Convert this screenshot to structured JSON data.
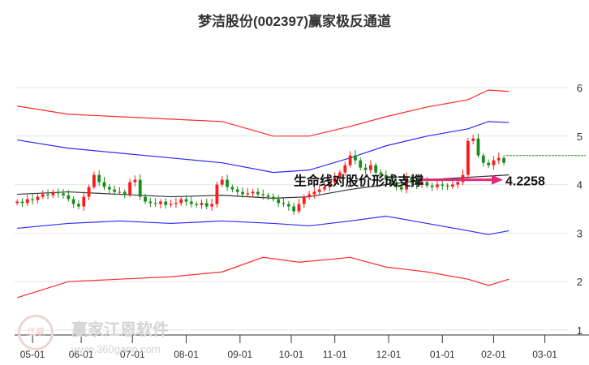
{
  "chart_data": {
    "type": "candlestick",
    "title": "梦洁股份(002397)赢家极反通道",
    "ylim": [
      1,
      6.5
    ],
    "yticks": [
      1,
      2,
      3,
      4,
      5,
      6
    ],
    "xtick_labels": [
      "05-01",
      "06-01",
      "07-01",
      "08-01",
      "09-01",
      "10-01",
      "11-01",
      "12-01",
      "01-01",
      "02-01",
      "03-01"
    ],
    "xtick_index": [
      3,
      12.5,
      22.5,
      33,
      43.5,
      53.5,
      62,
      72.5,
      83,
      93,
      103
    ],
    "closes": [
      3.65,
      3.62,
      3.7,
      3.68,
      3.75,
      3.8,
      3.78,
      3.85,
      3.82,
      3.78,
      3.7,
      3.6,
      3.55,
      3.75,
      3.95,
      4.2,
      4.05,
      3.95,
      3.9,
      3.85,
      3.85,
      3.8,
      4.05,
      4.1,
      3.75,
      3.65,
      3.62,
      3.6,
      3.65,
      3.58,
      3.6,
      3.62,
      3.7,
      3.65,
      3.6,
      3.58,
      3.62,
      3.55,
      3.6,
      4.0,
      4.1,
      3.95,
      3.9,
      3.85,
      3.8,
      3.82,
      3.85,
      3.8,
      3.78,
      3.75,
      3.7,
      3.62,
      3.6,
      3.55,
      3.45,
      3.6,
      3.75,
      3.8,
      3.85,
      3.9,
      3.95,
      4.05,
      4.15,
      4.25,
      4.4,
      4.6,
      4.5,
      4.35,
      4.3,
      4.4,
      4.25,
      4.2,
      4.1,
      4.05,
      3.95,
      3.9,
      4.15,
      4.05,
      4.0,
      4.05,
      3.98,
      3.95,
      4.0,
      3.98,
      3.96,
      4.0,
      4.05,
      4.2,
      4.9,
      4.95,
      4.6,
      4.45,
      4.4,
      4.5,
      4.55,
      4.45
    ],
    "x_count": 108,
    "series": [
      {
        "name": "upper-outer",
        "color": "#ff2a2a",
        "points": [
          [
            0,
            5.62
          ],
          [
            10,
            5.45
          ],
          [
            20,
            5.4
          ],
          [
            30,
            5.35
          ],
          [
            40,
            5.3
          ],
          [
            50,
            5.0
          ],
          [
            57,
            5.0
          ],
          [
            65,
            5.2
          ],
          [
            72,
            5.4
          ],
          [
            80,
            5.6
          ],
          [
            88,
            5.75
          ],
          [
            92,
            5.95
          ],
          [
            96,
            5.92
          ]
        ]
      },
      {
        "name": "upper-inner",
        "color": "#2a2aff",
        "points": [
          [
            0,
            4.92
          ],
          [
            10,
            4.75
          ],
          [
            20,
            4.65
          ],
          [
            30,
            4.55
          ],
          [
            40,
            4.45
          ],
          [
            50,
            4.25
          ],
          [
            57,
            4.3
          ],
          [
            65,
            4.55
          ],
          [
            72,
            4.8
          ],
          [
            80,
            5.0
          ],
          [
            88,
            5.15
          ],
          [
            92,
            5.3
          ],
          [
            96,
            5.28
          ]
        ]
      },
      {
        "name": "lifeline",
        "color": "#333333",
        "points": [
          [
            0,
            3.8
          ],
          [
            10,
            3.85
          ],
          [
            20,
            3.8
          ],
          [
            30,
            3.75
          ],
          [
            40,
            3.78
          ],
          [
            50,
            3.72
          ],
          [
            57,
            3.75
          ],
          [
            65,
            3.9
          ],
          [
            72,
            4.0
          ],
          [
            80,
            4.1
          ],
          [
            88,
            4.15
          ],
          [
            96,
            4.2
          ]
        ]
      },
      {
        "name": "lower-inner",
        "color": "#2a2aff",
        "points": [
          [
            0,
            3.1
          ],
          [
            10,
            3.2
          ],
          [
            20,
            3.25
          ],
          [
            30,
            3.2
          ],
          [
            40,
            3.25
          ],
          [
            50,
            3.2
          ],
          [
            57,
            3.15
          ],
          [
            65,
            3.25
          ],
          [
            72,
            3.35
          ],
          [
            80,
            3.2
          ],
          [
            88,
            3.05
          ],
          [
            92,
            2.97
          ],
          [
            96,
            3.05
          ]
        ]
      },
      {
        "name": "lower-outer",
        "color": "#ff2a2a",
        "points": [
          [
            0,
            1.67
          ],
          [
            10,
            2.0
          ],
          [
            20,
            2.05
          ],
          [
            30,
            2.1
          ],
          [
            40,
            2.2
          ],
          [
            48,
            2.5
          ],
          [
            55,
            2.4
          ],
          [
            65,
            2.5
          ],
          [
            72,
            2.3
          ],
          [
            80,
            2.2
          ],
          [
            88,
            2.05
          ],
          [
            92,
            1.92
          ],
          [
            96,
            2.05
          ]
        ]
      }
    ],
    "support_level": 4.6,
    "annotation": {
      "text": "生命线对股价形成支撑",
      "value": "4.2258",
      "arrow_price": 4.1
    }
  },
  "watermark": {
    "name": "赢家江恩软件",
    "url": "www.360gann.com",
    "seal": "江赢恩家"
  }
}
